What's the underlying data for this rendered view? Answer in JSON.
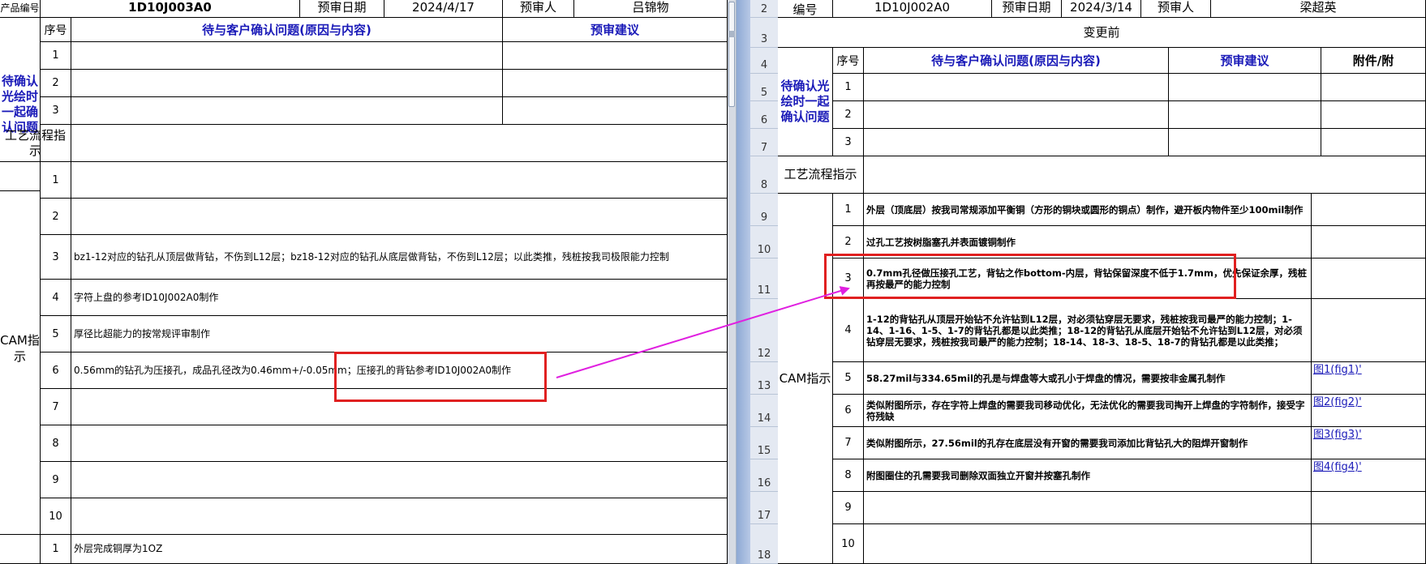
{
  "left": {
    "top_row": {
      "code_label": "产品编号",
      "code_value": "1D10J003A0",
      "date_label": "预审日期",
      "date_value": "2024/4/17",
      "reviewer_label": "预审人",
      "reviewer_value": "吕锦物"
    },
    "header": {
      "seq": "序号",
      "question": "待与客户确认问题(原因与内容)",
      "suggestion": "预审建议"
    },
    "confirm_label": "待确认光绘时一起确认问题",
    "confirm_rows": [
      "1",
      "2",
      "3"
    ],
    "process_label": "工艺流程指示",
    "cam_label": "CAM指示",
    "cam_rows": [
      {
        "no": "1",
        "text": ""
      },
      {
        "no": "2",
        "text": ""
      },
      {
        "no": "3",
        "text": "bz1-12对应的钻孔从顶层做背钻，不伤到L12层；bz18-12对应的钻孔从底层做背钻，不伤到L12层；以此类推，残桩按我司极限能力控制"
      },
      {
        "no": "4",
        "text": "字符上盘的参考ID10J002A0制作"
      },
      {
        "no": "5",
        "text": "厚径比超能力的按常规评审制作"
      },
      {
        "no": "6",
        "text": "0.56mm的钻孔为压接孔，成品孔径改为0.46mm+/-0.05mm；压接孔的背钻参考ID10J002A0制作"
      },
      {
        "no": "7",
        "text": ""
      },
      {
        "no": "8",
        "text": ""
      },
      {
        "no": "9",
        "text": ""
      },
      {
        "no": "10",
        "text": ""
      }
    ],
    "last_row": {
      "no": "1",
      "text": "外层完成铜厚为1OZ"
    }
  },
  "right": {
    "row_headers": [
      "2",
      "3",
      "4",
      "5",
      "6",
      "7",
      "8",
      "9",
      "10",
      "11",
      "12",
      "13",
      "14",
      "15",
      "16",
      "17",
      "18"
    ],
    "top_row": {
      "code_label": "编号",
      "code_value": "1D10J002A0",
      "date_label": "预审日期",
      "date_value": "2024/3/14",
      "reviewer_label": "预审人",
      "reviewer_value": "梁超英"
    },
    "before_change": "变更前",
    "header": {
      "seq": "序号",
      "question": "待与客户确认问题(原因与内容)",
      "suggestion": "预审建议",
      "attachment": "附件/附"
    },
    "confirm_label": "待确认光绘时一起确认问题",
    "confirm_rows": [
      "1",
      "2",
      "3"
    ],
    "process_label": "工艺流程指示",
    "cam_label": "CAM指示",
    "cam_rows": [
      {
        "no": "1",
        "text": "外层（顶底层）按我司常规添加平衡铜（方形的铜块或圆形的铜点）制作，避开板内物件至少100mil制作",
        "attach": ""
      },
      {
        "no": "2",
        "text": "过孔工艺按树脂塞孔并表面镀铜制作",
        "attach": ""
      },
      {
        "no": "3",
        "text": "0.7mm孔径做压接孔工艺，背钻之作bottom-内层，背钻保留深度不低于1.7mm，优先保证余厚，残桩再按最严的能力控制",
        "attach": ""
      },
      {
        "no": "4",
        "text": "1-12的背钻孔从顶层开始钻不允许钻到L12层，对必须钻穿层无要求，残桩按我司最严的能力控制；1-14、1-16、1-5、1-7的背钻孔都是以此类推；18-12的背钻孔从底层开始钻不允许钻到L12层，对必须钻穿层无要求，残桩按我司最严的能力控制；18-14、18-3、18-5、18-7的背钻孔都是以此类推；",
        "attach": ""
      },
      {
        "no": "5",
        "text": "58.27mil与334.65mil的孔是与焊盘等大或孔小于焊盘的情况，需要按非金属孔制作",
        "attach": "图1(fig1)'"
      },
      {
        "no": "6",
        "text": "类似附图所示，存在字符上焊盘的需要我司移动优化，无法优化的需要我司掏开上焊盘的字符制作，接受字符残缺",
        "attach": "图2(fig2)'"
      },
      {
        "no": "7",
        "text": "类似附图所示，27.56mil的孔存在底层没有开窗的需要我司添加比背钻孔大的阻焊开窗制作",
        "attach": "图3(fig3)'"
      },
      {
        "no": "8",
        "text": "附图圈住的孔需要我司删除双面独立开窗并按塞孔制作",
        "attach": "图4(fig4)'"
      },
      {
        "no": "9",
        "text": "",
        "attach": ""
      },
      {
        "no": "10",
        "text": "",
        "attach": ""
      }
    ]
  },
  "colors": {
    "header_blue": "#1a1ab8",
    "annotation_red": "#e02020",
    "arrow_magenta": "#e020e0",
    "row_header_bg": "#e4e9f2"
  }
}
